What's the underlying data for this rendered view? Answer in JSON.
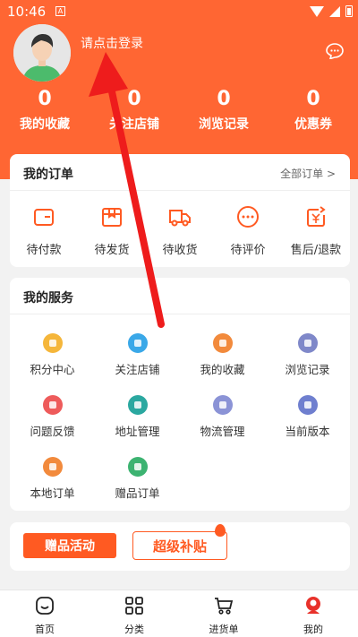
{
  "statusbar": {
    "time": "10:46",
    "a_icon": "A"
  },
  "header": {
    "login_text": "请点击登录",
    "stats": [
      {
        "value": "0",
        "label": "我的收藏"
      },
      {
        "value": "0",
        "label": "关注店铺"
      },
      {
        "value": "0",
        "label": "浏览记录"
      },
      {
        "value": "0",
        "label": "优惠券"
      }
    ]
  },
  "orders": {
    "title": "我的订单",
    "more": "全部订单 >",
    "items": [
      {
        "label": "待付款",
        "icon": "wallet-icon"
      },
      {
        "label": "待发货",
        "icon": "package-icon"
      },
      {
        "label": "待收货",
        "icon": "truck-icon"
      },
      {
        "label": "待评价",
        "icon": "comment-icon"
      },
      {
        "label": "售后/退款",
        "icon": "refund-icon"
      }
    ]
  },
  "services": {
    "title": "我的服务",
    "items": [
      {
        "label": "积分中心",
        "icon": "points-icon",
        "color": "#f5b63a"
      },
      {
        "label": "关注店铺",
        "icon": "heart-icon",
        "color": "#3aa8e8"
      },
      {
        "label": "我的收藏",
        "icon": "favorite-icon",
        "color": "#f28a3c"
      },
      {
        "label": "浏览记录",
        "icon": "history-icon",
        "color": "#7f88c9"
      },
      {
        "label": "问题反馈",
        "icon": "feedback-icon",
        "color": "#ee5b5b"
      },
      {
        "label": "地址管理",
        "icon": "location-icon",
        "color": "#2ba8a0"
      },
      {
        "label": "物流管理",
        "icon": "logistics-icon",
        "color": "#8b93d6"
      },
      {
        "label": "当前版本",
        "icon": "version-icon",
        "color": "#6f7fcf"
      },
      {
        "label": "本地订单",
        "icon": "local-order-icon",
        "color": "#f28a3c"
      },
      {
        "label": "赠品订单",
        "icon": "gift-order-icon",
        "color": "#3cb371"
      }
    ]
  },
  "promo": {
    "gift_label": "赠品活动",
    "subsidy_label": "超级补贴"
  },
  "tabbar": {
    "items": [
      {
        "label": "首页",
        "icon": "home-icon"
      },
      {
        "label": "分类",
        "icon": "grid-icon"
      },
      {
        "label": "进货单",
        "icon": "cart-icon"
      },
      {
        "label": "我的",
        "icon": "profile-icon"
      }
    ]
  },
  "colors": {
    "brand": "#ff6633",
    "accent": "#ff5a22",
    "arrow": "#ee1c1c"
  }
}
